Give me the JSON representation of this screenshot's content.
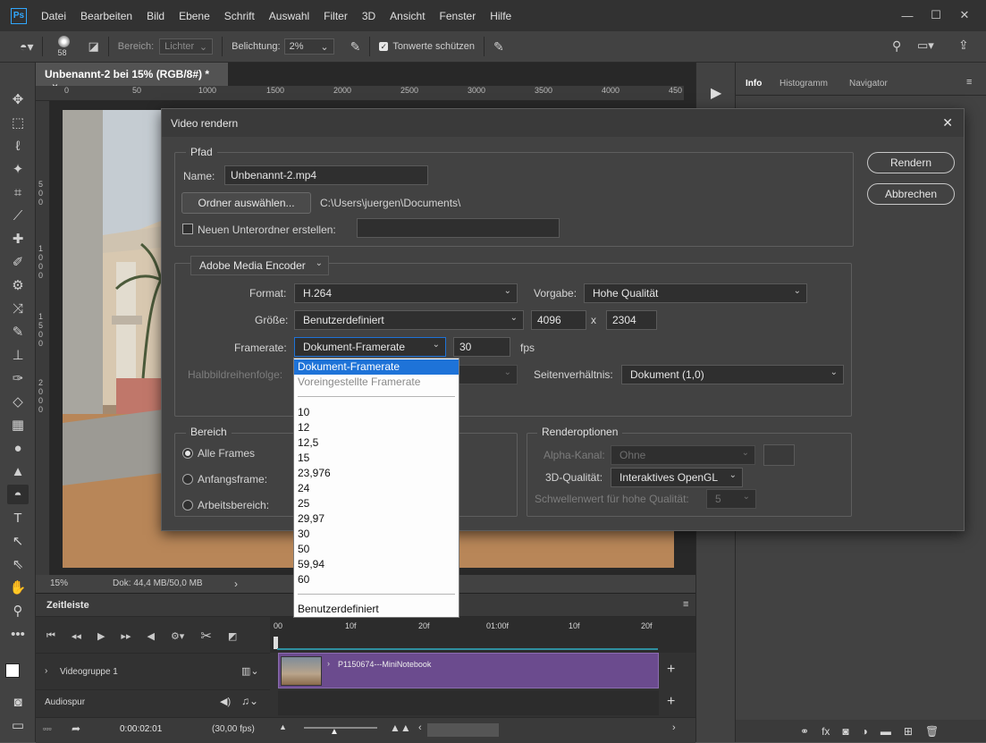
{
  "menubar": {
    "logo": "Ps",
    "items": [
      "Datei",
      "Bearbeiten",
      "Bild",
      "Ebene",
      "Schrift",
      "Auswahl",
      "Filter",
      "3D",
      "Ansicht",
      "Fenster",
      "Hilfe"
    ],
    "window_controls": [
      "—",
      "☐",
      "✕"
    ]
  },
  "optionsbar": {
    "brush_size": "58",
    "range_label": "Bereich:",
    "range_value": "Lichter",
    "exposure_label": "Belichtung:",
    "exposure_value": "2%",
    "protect_tones_label": "Tonwerte schützen",
    "protect_tones_checked": true
  },
  "document": {
    "tab_title": "Unbenannt-2 bei 15% (RGB/8#) *",
    "tab_close": "×",
    "ruler_top": [
      "0",
      "50",
      "1000",
      "1500",
      "2000",
      "2500",
      "3000",
      "3500",
      "4000",
      "450"
    ],
    "ruler_left": [
      "5",
      "0",
      "0",
      "1",
      "0",
      "0",
      "0",
      "1",
      "5",
      "0",
      "0",
      "2",
      "0",
      "0",
      "0"
    ],
    "zoom": "15%",
    "doc_info": "Dok: 44,4 MB/50,0 MB",
    "status_arrow": "›"
  },
  "timeline": {
    "title": "Zeitleiste",
    "time_ticks": [
      "00",
      "10f",
      "20f",
      "01:00f",
      "10f",
      "20f"
    ],
    "video_group": "Videogruppe 1",
    "clip_name": "P1150674---MiniNotebook",
    "audio_track": "Audiospur",
    "current_time": "0:00:02:01",
    "fps": "(30,00 fps)"
  },
  "right_panel": {
    "tabs": [
      "Info",
      "Histogramm",
      "Navigator"
    ],
    "active_tab": "Info"
  },
  "dialog": {
    "title": "Video rendern",
    "close": "✕",
    "path_group": "Pfad",
    "name_label": "Name:",
    "name_value": "Unbenannt-2.mp4",
    "choose_folder_button": "Ordner auswählen...",
    "folder_path": "C:\\Users\\juergen\\Documents\\",
    "subfolder_label": "Neuen Unterordner erstellen:",
    "subfolder_checked": false,
    "subfolder_value": "",
    "encoder": "Adobe Media Encoder",
    "format_label": "Format:",
    "format_value": "H.264",
    "preset_label": "Vorgabe:",
    "preset_value": "Hohe Qualität",
    "size_label": "Größe:",
    "size_value": "Benutzerdefiniert",
    "width": "4096",
    "size_x": "x",
    "height": "2304",
    "framerate_label": "Framerate:",
    "framerate_value": "Dokument-Framerate",
    "fps_value": "30",
    "fps_unit": "fps",
    "field_order_label": "Halbbildreihenfolge:",
    "aspect_label": "Seitenverhältnis:",
    "aspect_value": "Dokument (1,0)",
    "range_group": "Bereich",
    "all_frames": "Alle Frames",
    "start_frame": "Anfangsframe:",
    "work_area": "Arbeitsbereich:",
    "range_selected": "all",
    "render_options_group": "Renderoptionen",
    "alpha_label": "Alpha-Kanal:",
    "alpha_value": "Ohne",
    "quality3d_label": "3D-Qualität:",
    "quality3d_value": "Interaktives OpenGL",
    "threshold_label": "Schwellenwert für hohe Qualität:",
    "threshold_value": "5",
    "render_button": "Rendern",
    "cancel_button": "Abbrechen"
  },
  "framerate_dropdown": {
    "selected": "Dokument-Framerate",
    "preset": "Voreingestellte Framerate",
    "values": [
      "10",
      "12",
      "12,5",
      "15",
      "23,976",
      "24",
      "25",
      "29,97",
      "30",
      "50",
      "59,94",
      "60"
    ],
    "custom": "Benutzerdefiniert"
  },
  "colors": {
    "accent": "#1e73d8",
    "clip": "#6b4b8e",
    "dialog_bg": "#424242",
    "menubar_bg": "#323232"
  }
}
